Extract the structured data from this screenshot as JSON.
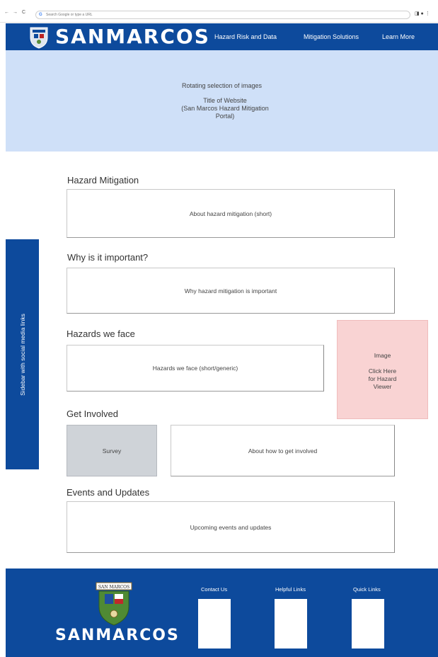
{
  "browser": {
    "back": "←",
    "forward": "→",
    "reload": "C",
    "address_icon": "G",
    "address_placeholder": "Search Google or type a URL",
    "right_icons": "◨ ● ⋮"
  },
  "header": {
    "logo": "SANMARCOS",
    "nav": [
      "Hazard Risk and Data",
      "Mitigation Solutions",
      "Learn More"
    ]
  },
  "hero": {
    "line1": "Rotating selection of images",
    "title_line1": "Title of Website",
    "title_line2": "(San Marcos Hazard Mitigation",
    "title_line3": "Portal)"
  },
  "sidebar": {
    "text": "Sidebar with social media links"
  },
  "sections": {
    "hazard_mitigation": {
      "heading": "Hazard Mitigation",
      "body": "About hazard mitigation (short)"
    },
    "why_important": {
      "heading": "Why is it important?",
      "body": "Why hazard mitigation is important"
    },
    "hazards": {
      "heading": "Hazards we face",
      "body": "Hazards we face (short/generic)"
    },
    "hazard_image": {
      "line1": "Image",
      "line2": "Click Here",
      "line3": "for Hazard",
      "line4": "Viewer"
    },
    "get_involved": {
      "heading": "Get Involved",
      "survey": "Survey",
      "body": "About how to get involved"
    },
    "events": {
      "heading": "Events and Updates",
      "body": "Upcoming events and updates"
    }
  },
  "footer": {
    "seal_text": "SAN MARCOS",
    "logo": "SANMARCOS",
    "columns": [
      "Contact Us",
      "Helpful Links",
      "Quick Links"
    ]
  },
  "colors": {
    "brand_blue": "#0d4a9c",
    "hero_blue": "#cfe0f8",
    "image_pink": "#f9d3d3",
    "survey_gray": "#cfd3d8"
  }
}
